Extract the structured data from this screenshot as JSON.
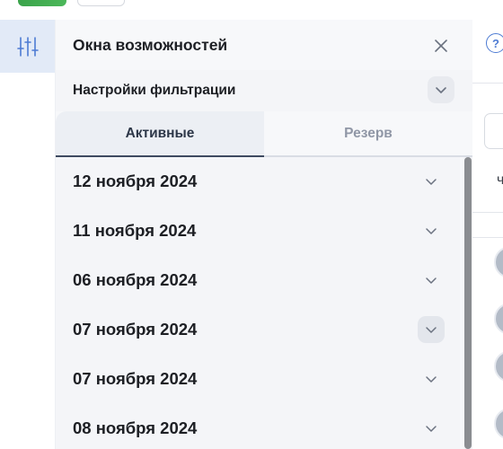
{
  "panel": {
    "title": "Окна возможностей",
    "filter_label": "Настройки фильтрации",
    "tabs": [
      {
        "label": "Активные",
        "active": true
      },
      {
        "label": "Резерв",
        "active": false
      }
    ],
    "items": [
      {
        "date": "12 ноября 2024"
      },
      {
        "date": "11 ноября 2024"
      },
      {
        "date": "06 ноября 2024"
      },
      {
        "date": "07 ноября 2024",
        "hovered": true
      },
      {
        "date": "07 ноября 2024"
      },
      {
        "date": "08 ноября 2024"
      }
    ]
  },
  "right": {
    "help_symbol": "?",
    "partial_glyph": "ч"
  },
  "icons": {
    "rail": "sliders-icon",
    "close": "close-icon",
    "filter_toggle": "chevron-down-icon",
    "item_toggle": "chevron-down-icon",
    "help": "help-icon"
  },
  "colors": {
    "accent": "#4d7bd3",
    "rail_active_bg": "#e2eaf7",
    "brand_green": "#3aa34a"
  }
}
